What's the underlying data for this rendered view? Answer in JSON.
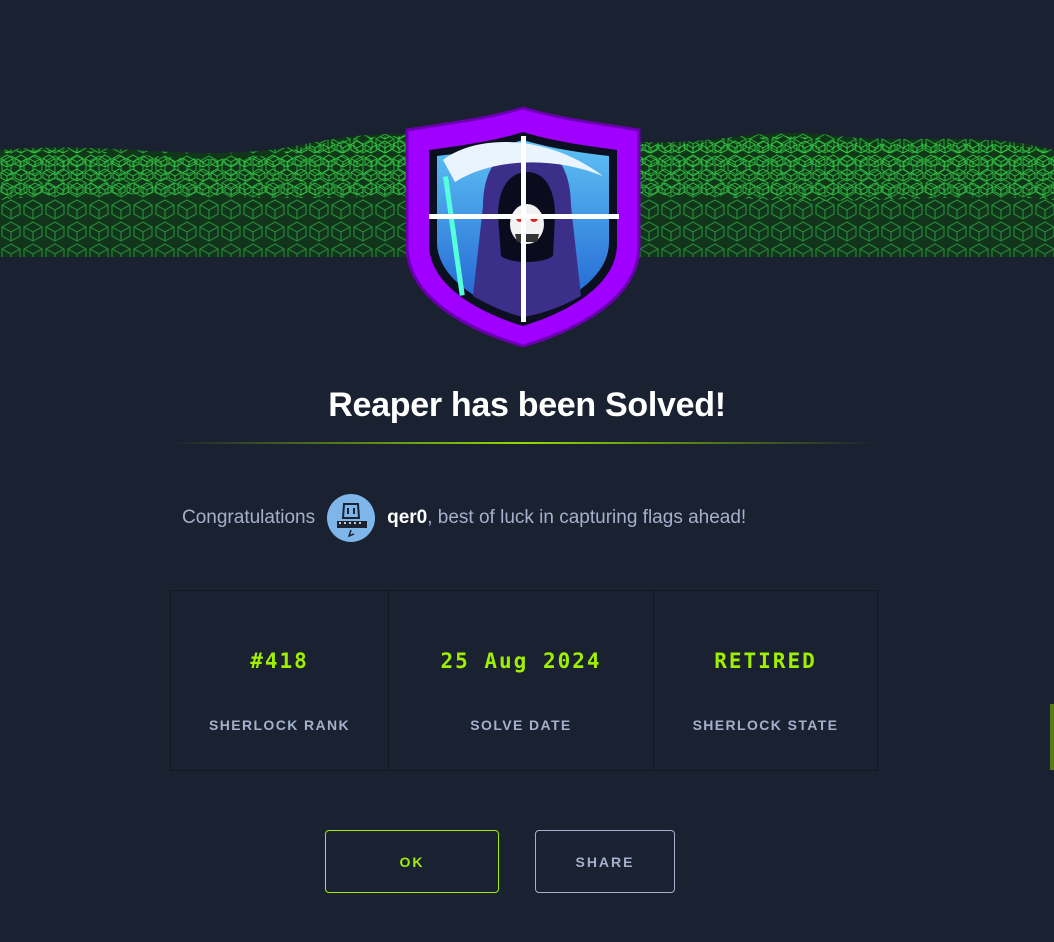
{
  "modal": {
    "title": "Reaper has been Solved!",
    "congrats_prefix": "Congratulations",
    "username": "qer0",
    "congrats_suffix": ", best of luck in capturing flags ahead!"
  },
  "stats": [
    {
      "value": "#418",
      "label": "SHERLOCK RANK"
    },
    {
      "value": "25 Aug 2024",
      "label": "SOLVE DATE"
    },
    {
      "value": "RETIRED",
      "label": "SHERLOCK STATE"
    }
  ],
  "buttons": {
    "ok_label": "OK",
    "share_label": "SHARE"
  },
  "badge": {
    "icon": "reaper-shield-icon"
  },
  "colors": {
    "background": "#1a2130",
    "accent_green": "#9fef00",
    "muted_text": "#a4b1cd",
    "badge_purple": "#9f00ff"
  }
}
